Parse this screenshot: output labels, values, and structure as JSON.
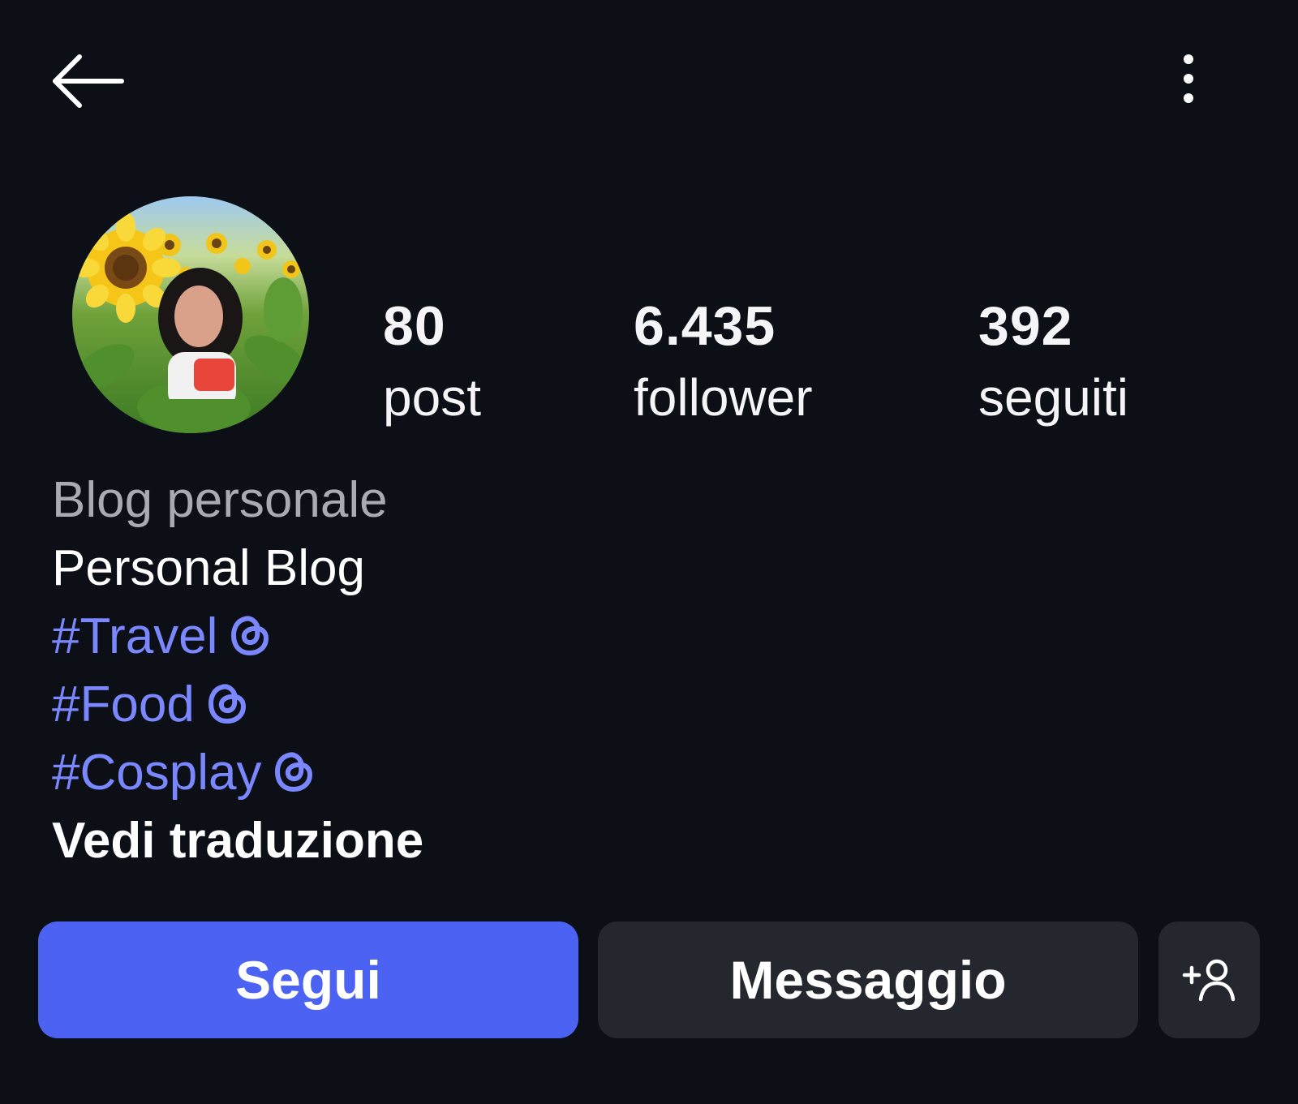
{
  "header": {
    "back_icon": "arrow-left-icon",
    "more_icon": "more-vertical-icon"
  },
  "profile": {
    "avatar": "profile-photo (woman in sunflower field)",
    "stats": [
      {
        "value": "80",
        "label": "post"
      },
      {
        "value": "6.435",
        "label": "follower"
      },
      {
        "value": "392",
        "label": "seguiti"
      }
    ]
  },
  "bio": {
    "category": "Blog personale",
    "text": "Personal Blog",
    "tags": [
      "#Travel",
      "#Food",
      "#Cosplay"
    ],
    "tag_icon": "threads-icon",
    "translate_label": "Vedi traduzione"
  },
  "actions": {
    "follow_label": "Segui",
    "message_label": "Messaggio",
    "add_icon": "add-user-icon"
  },
  "colors": {
    "background": "#0c0f16",
    "accent": "#4b62f3",
    "link": "#7a87ff",
    "button_secondary": "#25272e"
  }
}
